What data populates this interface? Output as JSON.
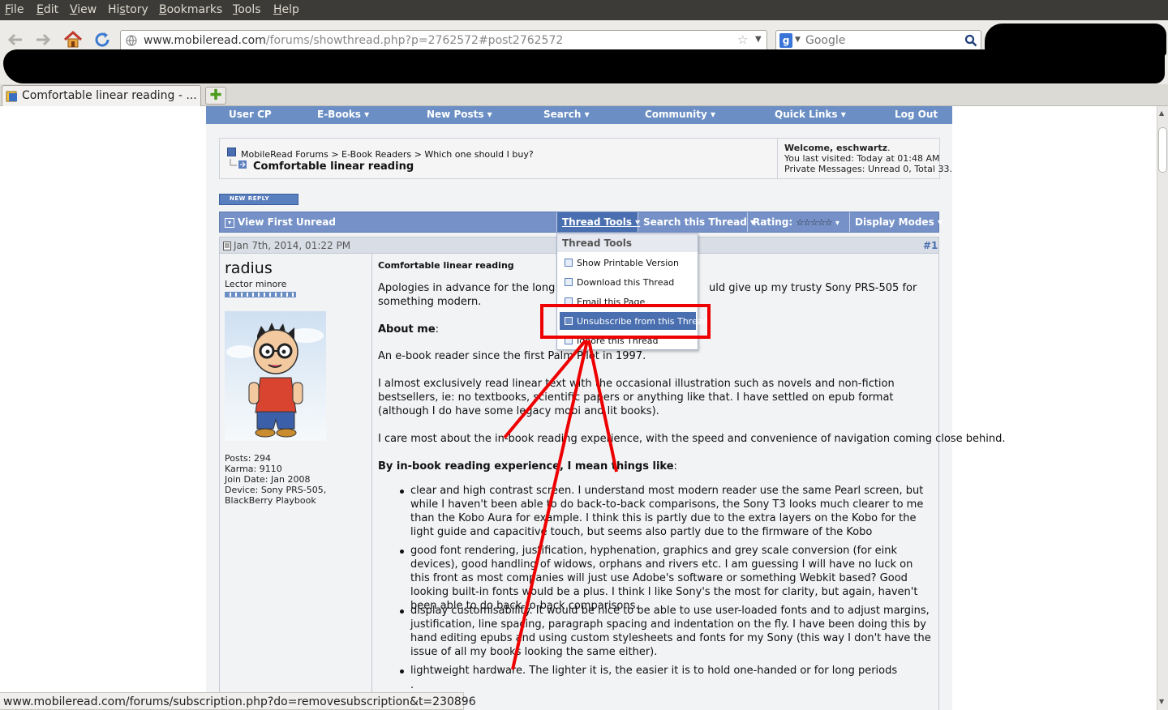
{
  "menubar": {
    "items": [
      "File",
      "Edit",
      "View",
      "History",
      "Bookmarks",
      "Tools",
      "Help"
    ],
    "mnemonics": [
      "F",
      "E",
      "V",
      "s",
      "B",
      "T",
      "H"
    ]
  },
  "navbar": {
    "url_host": "www.mobileread.com",
    "url_path": "/forums/showthread.php?p=2762572#post2762572",
    "search_engine_placeholder": "Google"
  },
  "tabs": [
    {
      "label": "Comfortable linear reading - ..."
    }
  ],
  "forum": {
    "topnav": [
      "User CP",
      "E-Books ▾",
      "New Posts ▾",
      "Search ▾",
      "Community ▾",
      "Quick Links ▾",
      "Log Out"
    ],
    "breadcrumb": {
      "site": "MobileRead Forums",
      "path": [
        "> E-Book Readers",
        "> Which one should I buy?"
      ],
      "thread_title": "Comfortable linear reading"
    },
    "welcome": {
      "line1_prefix": "Welcome, ",
      "user": "eschwartz",
      "line1_suffix": ".",
      "last_visit": "You last visited: Today at 01:48 AM",
      "messages": "Private Messages: Unread 0, Total 33."
    },
    "new_reply_label": "NEW REPLY",
    "threadbar": {
      "view_first_unread": "View First Unread",
      "thread_tools": "Thread Tools ▾",
      "search_thread": "Search this Thread ▾",
      "rating_label": "Rating:",
      "rating_stars": "☆☆☆☆☆",
      "rating_value": 0,
      "display_modes": "Display Modes ▾"
    },
    "thread_tools_menu": {
      "header": "Thread Tools",
      "items": [
        "Show Printable Version",
        "Download this Thread",
        "Email this Page",
        "Unsubscribe from this Thread",
        "Ignore this Thread"
      ],
      "highlighted_index": 3
    },
    "post": {
      "date": "Jan 7th, 2014, 01:22 PM",
      "number": "#1",
      "author": "radius",
      "rank": "Lector minore",
      "stats": [
        "Posts: 294",
        "Karma: 9110",
        "Join Date: Jan 2008",
        "Device: Sony PRS-505, BlackBerry Playbook"
      ],
      "title": "Comfortable linear reading",
      "intro_1": "Apologies in advance for the long post",
      "intro_2": "uld give up my trusty Sony PRS-505 for",
      "intro_3": "something modern.",
      "about_heading": "About me",
      "about_colon": ":",
      "about_text": "An e-book reader since the first Palm Pilot in 1997.",
      "para2": "I almost exclusively read linear text with the occasional illustration such as novels and non-fiction bestsellers, ie: no textbooks, scientific papers or anything like that. I have settled on epub format (although I do have some legacy mobi and lit books).",
      "para3": "I care most about the in-book reading experience, with the speed and convenience of navigation coming close behind.",
      "para4_bold": "By in-book reading experience, I mean things like",
      "para4_colon": ":",
      "bullets": [
        "clear and high contrast screen. I understand most modern reader use the same Pearl screen, but while I haven't been able to do back-to-back comparisons, the Sony T3 looks much clearer to me than the Kobo Aura for example. I think this is partly due to the extra layers on the Kobo for the light guide and capacitive touch, but seems also partly due to the firmware of the Kobo",
        "good font rendering, justification, hyphenation, graphics and grey scale conversion (for eink devices), good handling of widows, orphans and rivers etc. I am guessing I will have no luck on this front as most companies will just use Adobe's software or something Webkit based? Good looking built-in fonts would be a plus. I think I like Sony's the most for clarity, but again, haven't been able to do back-to-back comparisons.",
        "display customisability. It would be nice to be able to use user-loaded fonts and to adjust margins, justification, line spacing, paragraph spacing and indentation on the fly. I have been doing this by hand editing epubs and using custom stylesheets and fonts for my Sony (this way I don't have the issue of all my books looking the same either).",
        "lightweight hardware. The lighter it is, the easier it is to hold one-handed or for long periods"
      ],
      "trailing": "."
    }
  },
  "statusbar": {
    "text": "www.mobileread.com/forums/subscription.php?do=removesubscription&t=230896"
  },
  "colors": {
    "menubar_bg": "#3c3b37",
    "forum_nav": "#6b8fc4",
    "menu_highlight": "#4a6fb0",
    "annotation_red": "#ee0000"
  }
}
